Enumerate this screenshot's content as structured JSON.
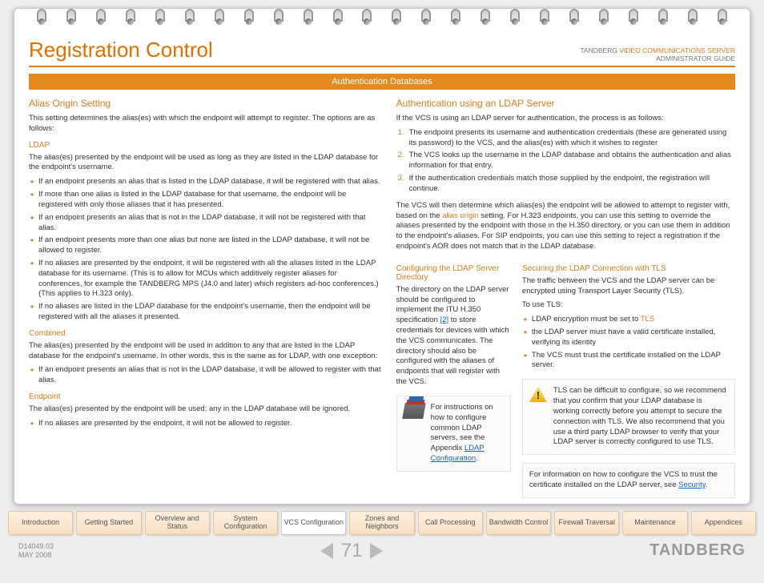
{
  "header": {
    "title": "Registration Control",
    "guide_line1_plain": "TANDBERG ",
    "guide_line1_orange": "VIDEO COMMUNICATIONS SERVER",
    "guide_line2": "ADMINISTRATOR GUIDE",
    "section_bar": "Authentication Databases"
  },
  "left": {
    "h_alias": "Alias Origin Setting",
    "p_intro": "This setting determines the alias(es) with which the endpoint will attempt to register.  The options are as follows:",
    "h_ldap": "LDAP",
    "p_ldap": "The alias(es) presented by the endpoint will be used as long as they are listed in the LDAP database for the endpoint's username.",
    "ldap_items": [
      "If an endpoint presents an alias that is listed in the LDAP database, it will be registered with that alias.",
      "If more than one alias is listed in the LDAP database for that username, the endpoint will be registered with only those aliases that it has presented.",
      "If an endpoint presents an alias that is not in the LDAP database, it will not be registered with that alias.",
      "If an endpoint presents more than one alias but none are listed in the LDAP database, it will not be allowed to register.",
      "If no aliases are presented by the endpoint, it will be registered with all the aliases listed in the LDAP database for its username. (This is to allow for MCUs which additively register aliases for conferences, for example the TANDBERG MPS (J4.0 and later) which registers ad-hoc conferences.) (This applies to H.323 only).",
      "If no aliases are listed in the LDAP database for the endpoint's username, then the endpoint will be registered with all the aliases it presented."
    ],
    "h_combined": "Combined",
    "p_combined": "The alias(es) presented by the endpoint will be used in addition to any that are listed in the LDAP database for the endpoint's username. In other words, this is the same as for LDAP, with one exception:",
    "combined_items": [
      "If an endpoint presents an alias that is not in the LDAP database, it will be allowed to register with that alias."
    ],
    "h_endpoint": "Endpoint",
    "p_endpoint": "The alias(es) presented by the endpoint will be used; any in the LDAP database will be ignored.",
    "endpoint_items": [
      "If no aliases are presented by the endpoint, it will not be allowed to register."
    ]
  },
  "right": {
    "h_auth": "Authentication using an LDAP Server",
    "p_auth_intro": "If the VCS is using an LDAP server for authentication, the process is as follows:",
    "auth_steps": [
      "The endpoint presents its username and authentication credentials (these are generated using its password) to the VCS, and the alias(es) with which it wishes to register",
      "The VCS looks up the username in the LDAP database and obtains the authentication and alias information for that entry.",
      "If the authentication credentials match those supplied by the endpoint, the registration will continue."
    ],
    "p_auth_post_a": "The VCS will then determine which alias(es) the endpoint will be allowed to attempt to register with, based on the ",
    "alias_link": "alias origin",
    "p_auth_post_b": " setting.  For H.323 endpoints, you can use this setting to override the aliases presented by the endpoint with those in the H.350 directory, or you can use them in addition to the endpoint's aliases.  For SIP endpoints, you can use this setting to reject a registration if the endpoint's AOR does not match that in the LDAP database.",
    "subleft": {
      "h": "Configuring the LDAP Server Directory",
      "p_a": "The directory on the LDAP server should be configured to implement the ITU H.350 specification ",
      "ref": "[2]",
      "p_b": " to store credentials for devices with which the VCS communicates. The directory should also be configured with the aliases of endpoints that will register with the VCS.",
      "note_a": "For instructions on how to configure common LDAP servers, see the Appendix ",
      "note_link": "LDAP Configuration",
      "note_b": "."
    },
    "subright": {
      "h": "Securing the LDAP Connection with TLS",
      "p1": "The traffic between the VCS and the LDAP server can be encrypted using Transport Layer Security (TLS).",
      "p2": "To use TLS:",
      "items_pre": [
        "LDAP encryption must be set to "
      ],
      "tls_word": "TLS",
      "items_rest": [
        "the LDAP server must have a valid certificate installed, verifying its identity",
        "The VCS must trust the certificate installed on the LDAP server."
      ],
      "warn": "TLS can be difficult to configure, so we recommend that you confirm that your LDAP database is working correctly before you attempt to secure the connection with TLS. We also recommend that you use a third party LDAP browser to verify that your LDAP server is correctly configured to use TLS.",
      "info_a": "For information on how to configure the VCS to trust the certificate installed on the LDAP server, see ",
      "info_link": "Security",
      "info_b": "."
    }
  },
  "tabs": [
    {
      "label": "Introduction",
      "active": false
    },
    {
      "label": "Getting Started",
      "active": false
    },
    {
      "label": "Overview and Status",
      "active": false
    },
    {
      "label": "System Configuration",
      "active": false
    },
    {
      "label": "VCS Configuration",
      "active": true
    },
    {
      "label": "Zones and Neighbors",
      "active": false
    },
    {
      "label": "Call Processing",
      "active": false
    },
    {
      "label": "Bandwidth Control",
      "active": false
    },
    {
      "label": "Firewall Traversal",
      "active": false
    },
    {
      "label": "Maintenance",
      "active": false
    },
    {
      "label": "Appendices",
      "active": false
    }
  ],
  "footer": {
    "doc_id": "D14049.03",
    "date": "MAY 2008",
    "page": "71",
    "brand": "TANDBERG"
  }
}
